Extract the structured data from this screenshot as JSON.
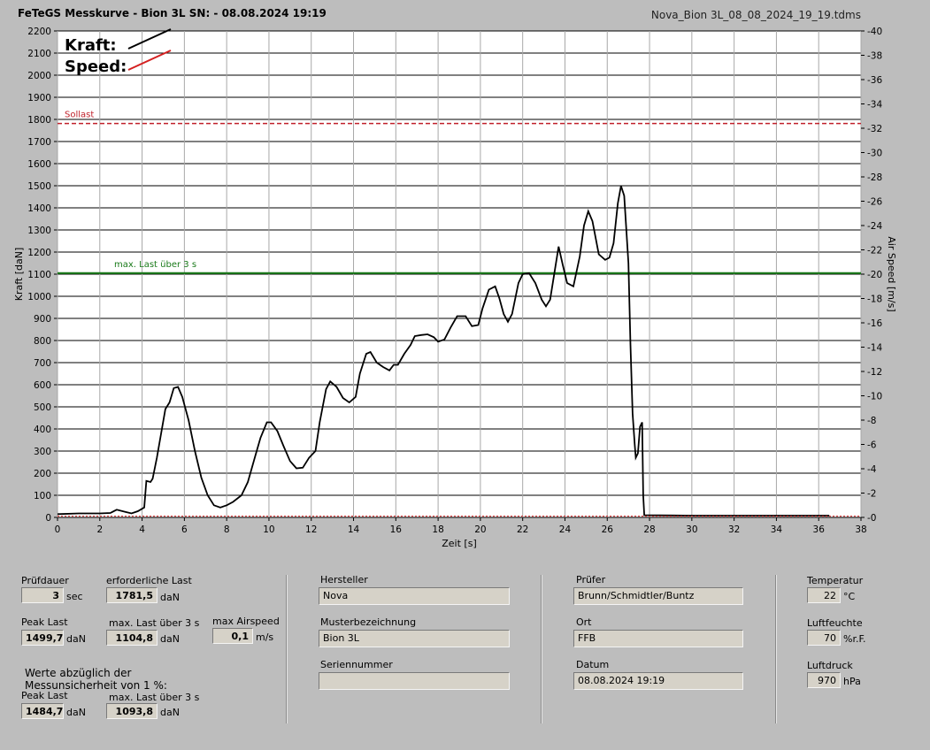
{
  "header": {
    "title": "FeTeGS Messkurve - Bion 3L  SN:  - 08.08.2024 19:19",
    "file": "Nova_Bion 3L_08_08_2024_19_19.tdms"
  },
  "chart_data": {
    "type": "line",
    "xlabel": "Zeit [s]",
    "ylabel_left": "Kraft [daN]",
    "ylabel_right": "Air Speed [m/s]",
    "xlim": [
      0,
      38
    ],
    "ylim_left": [
      0,
      2200
    ],
    "ylim_right": [
      0,
      40
    ],
    "x_ticks": [
      "0",
      "2",
      "4",
      "6",
      "8",
      "10",
      "12",
      "14",
      "16",
      "18",
      "20",
      "22",
      "24",
      "26",
      "28",
      "30",
      "32",
      "34",
      "36",
      "38"
    ],
    "y_ticks_left": [
      "0",
      "100",
      "200",
      "300",
      "400",
      "500",
      "600",
      "700",
      "800",
      "900",
      "1000",
      "1100",
      "1200",
      "1300",
      "1400",
      "1500",
      "1600",
      "1700",
      "1800",
      "1900",
      "2000",
      "2100",
      "2200"
    ],
    "y_ticks_right": [
      "0",
      "2",
      "4",
      "6",
      "8",
      "10",
      "12",
      "14",
      "16",
      "18",
      "20",
      "22",
      "24",
      "26",
      "28",
      "30",
      "32",
      "34",
      "36",
      "38",
      "40"
    ],
    "legend": [
      {
        "label": "Kraft:",
        "color": "#000000"
      },
      {
        "label": "Speed:",
        "color": "#d42020"
      }
    ],
    "legend_position": "top-left",
    "grid": true,
    "reference_lines": [
      {
        "label": "Sollast",
        "value": 1781.5,
        "color": "#c0202a",
        "style": "dashed"
      },
      {
        "label": "max. Last über  3 s",
        "value": 1104.8,
        "color": "#1a7a1a",
        "style": "solid"
      }
    ],
    "series": [
      {
        "name": "Kraft",
        "color": "#000000",
        "points": [
          [
            0,
            15
          ],
          [
            1,
            18
          ],
          [
            2,
            18
          ],
          [
            2.5,
            20
          ],
          [
            2.8,
            35
          ],
          [
            3.2,
            25
          ],
          [
            3.5,
            18
          ],
          [
            3.8,
            28
          ],
          [
            4.1,
            45
          ],
          [
            4.2,
            165
          ],
          [
            4.4,
            160
          ],
          [
            4.5,
            175
          ],
          [
            4.7,
            270
          ],
          [
            4.9,
            380
          ],
          [
            5.1,
            490
          ],
          [
            5.3,
            520
          ],
          [
            5.5,
            585
          ],
          [
            5.7,
            590
          ],
          [
            5.9,
            545
          ],
          [
            6.2,
            440
          ],
          [
            6.5,
            300
          ],
          [
            6.8,
            180
          ],
          [
            7.1,
            100
          ],
          [
            7.4,
            55
          ],
          [
            7.7,
            45
          ],
          [
            8.0,
            55
          ],
          [
            8.3,
            70
          ],
          [
            8.7,
            100
          ],
          [
            9.0,
            160
          ],
          [
            9.3,
            260
          ],
          [
            9.6,
            360
          ],
          [
            9.9,
            430
          ],
          [
            10.1,
            430
          ],
          [
            10.4,
            390
          ],
          [
            10.7,
            320
          ],
          [
            11.0,
            255
          ],
          [
            11.3,
            222
          ],
          [
            11.6,
            225
          ],
          [
            11.9,
            270
          ],
          [
            12.2,
            300
          ],
          [
            12.4,
            430
          ],
          [
            12.7,
            580
          ],
          [
            12.9,
            615
          ],
          [
            13.2,
            590
          ],
          [
            13.5,
            540
          ],
          [
            13.8,
            520
          ],
          [
            14.1,
            545
          ],
          [
            14.3,
            650
          ],
          [
            14.6,
            740
          ],
          [
            14.8,
            748
          ],
          [
            15.1,
            700
          ],
          [
            15.4,
            680
          ],
          [
            15.7,
            665
          ],
          [
            15.9,
            690
          ],
          [
            16.1,
            690
          ],
          [
            16.4,
            740
          ],
          [
            16.7,
            780
          ],
          [
            16.9,
            820
          ],
          [
            17.2,
            825
          ],
          [
            17.5,
            828
          ],
          [
            17.8,
            815
          ],
          [
            18.0,
            795
          ],
          [
            18.3,
            805
          ],
          [
            18.6,
            860
          ],
          [
            18.9,
            910
          ],
          [
            19.3,
            910
          ],
          [
            19.6,
            865
          ],
          [
            19.9,
            870
          ],
          [
            20.1,
            945
          ],
          [
            20.4,
            1030
          ],
          [
            20.7,
            1045
          ],
          [
            20.9,
            990
          ],
          [
            21.1,
            920
          ],
          [
            21.3,
            885
          ],
          [
            21.5,
            920
          ],
          [
            21.8,
            1060
          ],
          [
            22.0,
            1100
          ],
          [
            22.3,
            1105
          ],
          [
            22.6,
            1060
          ],
          [
            22.9,
            985
          ],
          [
            23.1,
            955
          ],
          [
            23.3,
            985
          ],
          [
            23.5,
            1105
          ],
          [
            23.7,
            1225
          ],
          [
            23.9,
            1140
          ],
          [
            24.1,
            1060
          ],
          [
            24.4,
            1045
          ],
          [
            24.7,
            1180
          ],
          [
            24.9,
            1320
          ],
          [
            25.1,
            1385
          ],
          [
            25.3,
            1340
          ],
          [
            25.6,
            1190
          ],
          [
            25.9,
            1165
          ],
          [
            26.1,
            1175
          ],
          [
            26.3,
            1240
          ],
          [
            26.5,
            1420
          ],
          [
            26.65,
            1499.7
          ],
          [
            26.8,
            1455
          ],
          [
            27.0,
            1150
          ],
          [
            27.1,
            780
          ],
          [
            27.2,
            470
          ],
          [
            27.3,
            330
          ],
          [
            27.35,
            270
          ],
          [
            27.45,
            290
          ],
          [
            27.55,
            410
          ],
          [
            27.65,
            430
          ],
          [
            27.7,
            100
          ],
          [
            27.75,
            10
          ],
          [
            30,
            8
          ],
          [
            33,
            8
          ],
          [
            36.5,
            8
          ]
        ]
      },
      {
        "name": "Speed",
        "color": "#d42020",
        "points": [
          [
            0,
            0.1
          ],
          [
            38,
            0.1
          ]
        ]
      }
    ]
  },
  "left_panel": {
    "pruefdauer_label": "Prüfdauer",
    "pruefdauer_value": "3",
    "pruefdauer_unit": "sec",
    "erf_last_label": "erforderliche Last",
    "erf_last_value": "1781,5",
    "erf_last_unit": "daN",
    "peak_label": "Peak Last",
    "peak_value": "1499,7",
    "peak_unit": "daN",
    "maxlast_label": "max. Last über  3 s",
    "maxlast_value": "1104,8",
    "maxlast_unit": "daN",
    "airspeed_label": "max Airspeed",
    "airspeed_value": "0,1",
    "airspeed_unit": "m/s",
    "werte_line1": "Werte abzüglich der",
    "werte_line2": "Messunsicherheit von 1   %:",
    "peak2_label": "Peak Last",
    "peak2_value": "1484,7",
    "peak2_unit": "daN",
    "maxlast2_label": "max. Last über  3 s",
    "maxlast2_value": "1093,8",
    "maxlast2_unit": "daN"
  },
  "mid_panel": {
    "hersteller_label": "Hersteller",
    "hersteller_value": "Nova",
    "muster_label": "Musterbezeichnung",
    "muster_value": "Bion 3L",
    "serien_label": "Seriennummer",
    "serien_value": ""
  },
  "right_panel": {
    "pruefer_label": "Prüfer",
    "pruefer_value": "Brunn/Schmidtler/Buntz",
    "ort_label": "Ort",
    "ort_value": "FFB",
    "datum_label": "Datum",
    "datum_value": "08.08.2024 19:19"
  },
  "env_panel": {
    "temp_label": "Temperatur",
    "temp_value": "22",
    "temp_unit": "°C",
    "feuchte_label": "Luftfeuchte",
    "feuchte_value": "70",
    "feuchte_unit": "%r.F.",
    "druck_label": "Luftdruck",
    "druck_value": "970",
    "druck_unit": "hPa"
  }
}
